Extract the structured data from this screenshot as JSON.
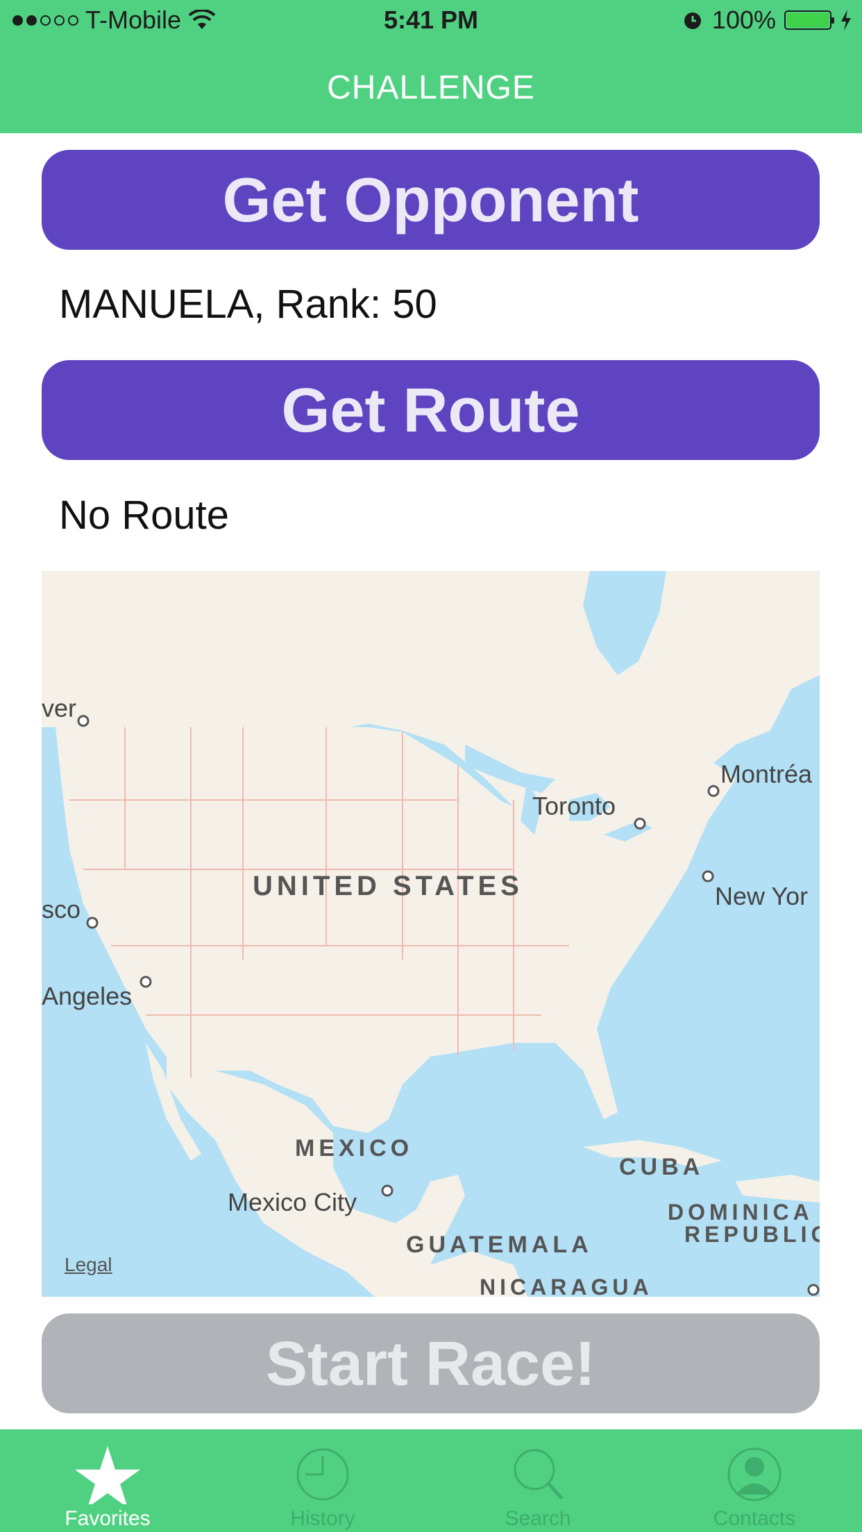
{
  "status_bar": {
    "carrier": "T-Mobile",
    "time": "5:41 PM",
    "battery": "100%",
    "battery_level": 1.0
  },
  "nav": {
    "title": "CHALLENGE"
  },
  "opponent": {
    "button_label": "Get Opponent",
    "result": "MANUELA, Rank: 50"
  },
  "route": {
    "button_label": "Get Route",
    "result": "No Route"
  },
  "map": {
    "labels": {
      "vancouver": "ver",
      "montreal": "Montréa",
      "toronto": "Toronto",
      "united_states": "UNITED STATES",
      "new_york": "New Yor",
      "san_francisco": "sco",
      "los_angeles": "Angeles",
      "mexico": "MEXICO",
      "cuba": "CUBA",
      "mexico_city": "Mexico City",
      "dominican_1": "DOMINICA",
      "dominican_2": "REPUBLIC",
      "guatemala": "GUATEMALA",
      "nicaragua": "NICARAGUA"
    },
    "legal": "Legal"
  },
  "start": {
    "button_label": "Start Race!"
  },
  "tabs": [
    {
      "label": "Favorites",
      "icon": "star-icon",
      "active": true
    },
    {
      "label": "History",
      "icon": "clock-icon",
      "active": false
    },
    {
      "label": "Search",
      "icon": "search-icon",
      "active": false
    },
    {
      "label": "Contacts",
      "icon": "person-icon",
      "active": false
    }
  ]
}
